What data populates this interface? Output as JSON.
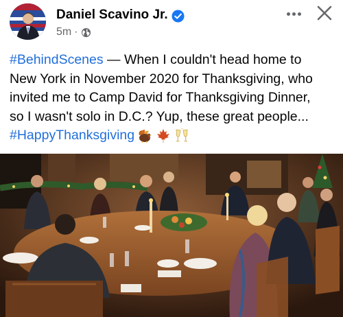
{
  "author": {
    "name": "Daniel Scavino Jr.",
    "verified": true,
    "time": "5m",
    "separator": "·",
    "privacy_icon": "globe-icon"
  },
  "controls": {
    "more_icon": "more-options-icon",
    "close_icon": "close-icon"
  },
  "post": {
    "hashtag_1": "#BehindScenes",
    "line_1_rest": " — When I couldn't head home to",
    "line_2": "New York in November 2020 for Thanksgiving, who",
    "line_3": "invited me to Camp David for Thanksgiving Dinner,",
    "line_4": "so I wasn't solo in D.C.? Yup, these great people...",
    "hashtag_2": "#HappyThanksgiving",
    "emojis": [
      "turkey-icon",
      "maple-leaf-icon",
      "clinking-glasses-icon"
    ]
  },
  "photo": {
    "alt_subject": "dinner-table-photo"
  },
  "colors": {
    "hashtag": "#216fdb",
    "verified": "#1877f2",
    "meta": "#65676b"
  }
}
